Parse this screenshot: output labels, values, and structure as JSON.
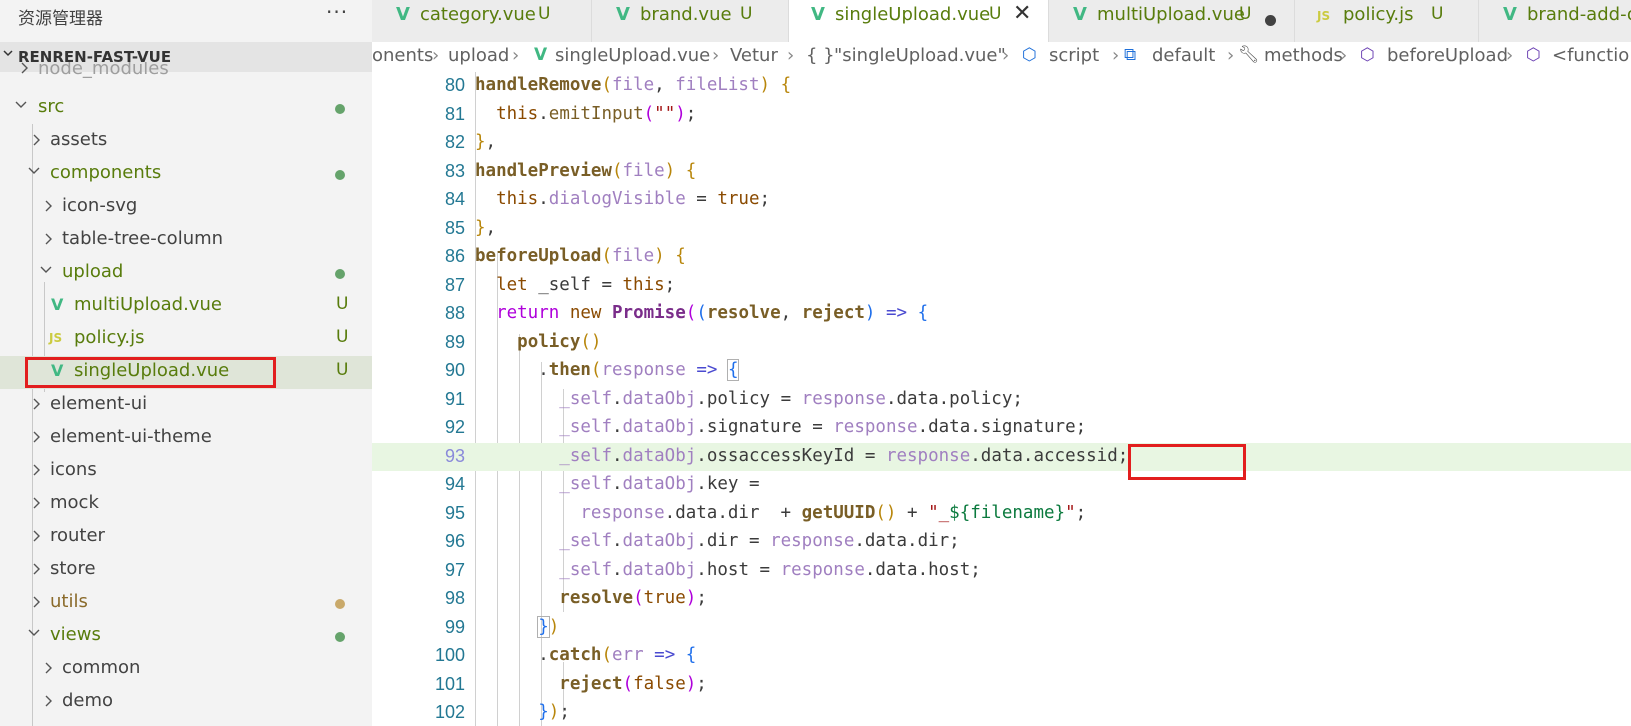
{
  "explorer": {
    "title": "资源管理器",
    "more": "···",
    "project": "RENREN-FAST-VUE",
    "items": [
      {
        "label": "node_modules",
        "kind": "folder",
        "status": ""
      },
      {
        "label": "src",
        "kind": "folder",
        "status": "dot-green"
      },
      {
        "label": "assets",
        "kind": "folder",
        "status": ""
      },
      {
        "label": "components",
        "kind": "folder",
        "status": "dot-green"
      },
      {
        "label": "icon-svg",
        "kind": "folder",
        "status": ""
      },
      {
        "label": "table-tree-column",
        "kind": "folder",
        "status": ""
      },
      {
        "label": "upload",
        "kind": "folder",
        "status": "dot-green"
      },
      {
        "label": "multiUpload.vue",
        "kind": "vue",
        "status": "U"
      },
      {
        "label": "policy.js",
        "kind": "js",
        "status": "U"
      },
      {
        "label": "singleUpload.vue",
        "kind": "vue",
        "status": "U"
      },
      {
        "label": "element-ui",
        "kind": "folder",
        "status": ""
      },
      {
        "label": "element-ui-theme",
        "kind": "folder",
        "status": ""
      },
      {
        "label": "icons",
        "kind": "folder",
        "status": ""
      },
      {
        "label": "mock",
        "kind": "folder",
        "status": ""
      },
      {
        "label": "router",
        "kind": "folder",
        "status": ""
      },
      {
        "label": "store",
        "kind": "folder",
        "status": ""
      },
      {
        "label": "utils",
        "kind": "folder",
        "status": "dot-yellow"
      },
      {
        "label": "views",
        "kind": "folder",
        "status": "dot-green"
      },
      {
        "label": "common",
        "kind": "folder",
        "status": ""
      },
      {
        "label": "demo",
        "kind": "folder",
        "status": ""
      }
    ],
    "js_icon_text": "JS",
    "vue_icon_text": "V",
    "colors": {
      "untracked": "#587c0c",
      "dot_green": "#65a36b",
      "dot_yellow": "#c9a96a",
      "highlight": "#e21e1e"
    }
  },
  "tabs": [
    {
      "label": "category.vue",
      "badge": "U",
      "icon": "vue",
      "state": ""
    },
    {
      "label": "brand.vue",
      "badge": "U",
      "icon": "vue",
      "state": ""
    },
    {
      "label": "singleUpload.vue",
      "badge": "U",
      "icon": "vue",
      "state": "active",
      "close": "✕"
    },
    {
      "label": "multiUpload.vue",
      "badge": "U",
      "icon": "vue",
      "state": "modified"
    },
    {
      "label": "policy.js",
      "badge": "U",
      "icon": "js",
      "state": ""
    },
    {
      "label": "brand-add-o",
      "badge": "",
      "icon": "vue",
      "state": ""
    }
  ],
  "breadcrumb": [
    "onents",
    "upload",
    "singleUpload.vue",
    "Vetur",
    "\"singleUpload.vue\"",
    "script",
    "default",
    "methods",
    "beforeUpload",
    "<functio"
  ],
  "breadcrumb_prefix": "{ }",
  "editor": {
    "current_line": 93,
    "line_numbers": [
      80,
      81,
      82,
      83,
      84,
      85,
      86,
      87,
      88,
      89,
      90,
      91,
      92,
      93,
      94,
      95,
      96,
      97,
      98,
      99,
      100,
      101,
      102
    ],
    "lines": [
      "handleRemove(file, fileList) {",
      "  this.emitInput(\"\");",
      "},",
      "handlePreview(file) {",
      "  this.dialogVisible = true;",
      "},",
      "beforeUpload(file) {",
      "  let _self = this;",
      "  return new Promise((resolve, reject) => {",
      "    policy()",
      "      .then(response => {",
      "        _self.dataObj.policy = response.data.policy;",
      "        _self.dataObj.signature = response.data.signature;",
      "        _self.dataObj.ossaccessKeyId = response.data.accessid;",
      "        _self.dataObj.key =",
      "          response.data.dir  + getUUID() + \"_${filename}\";",
      "        _self.dataObj.dir = response.data.dir;",
      "        _self.dataObj.host = response.data.host;",
      "        resolve(true);",
      "      })",
      "      .catch(err => {",
      "        reject(false);",
      "      });"
    ]
  }
}
